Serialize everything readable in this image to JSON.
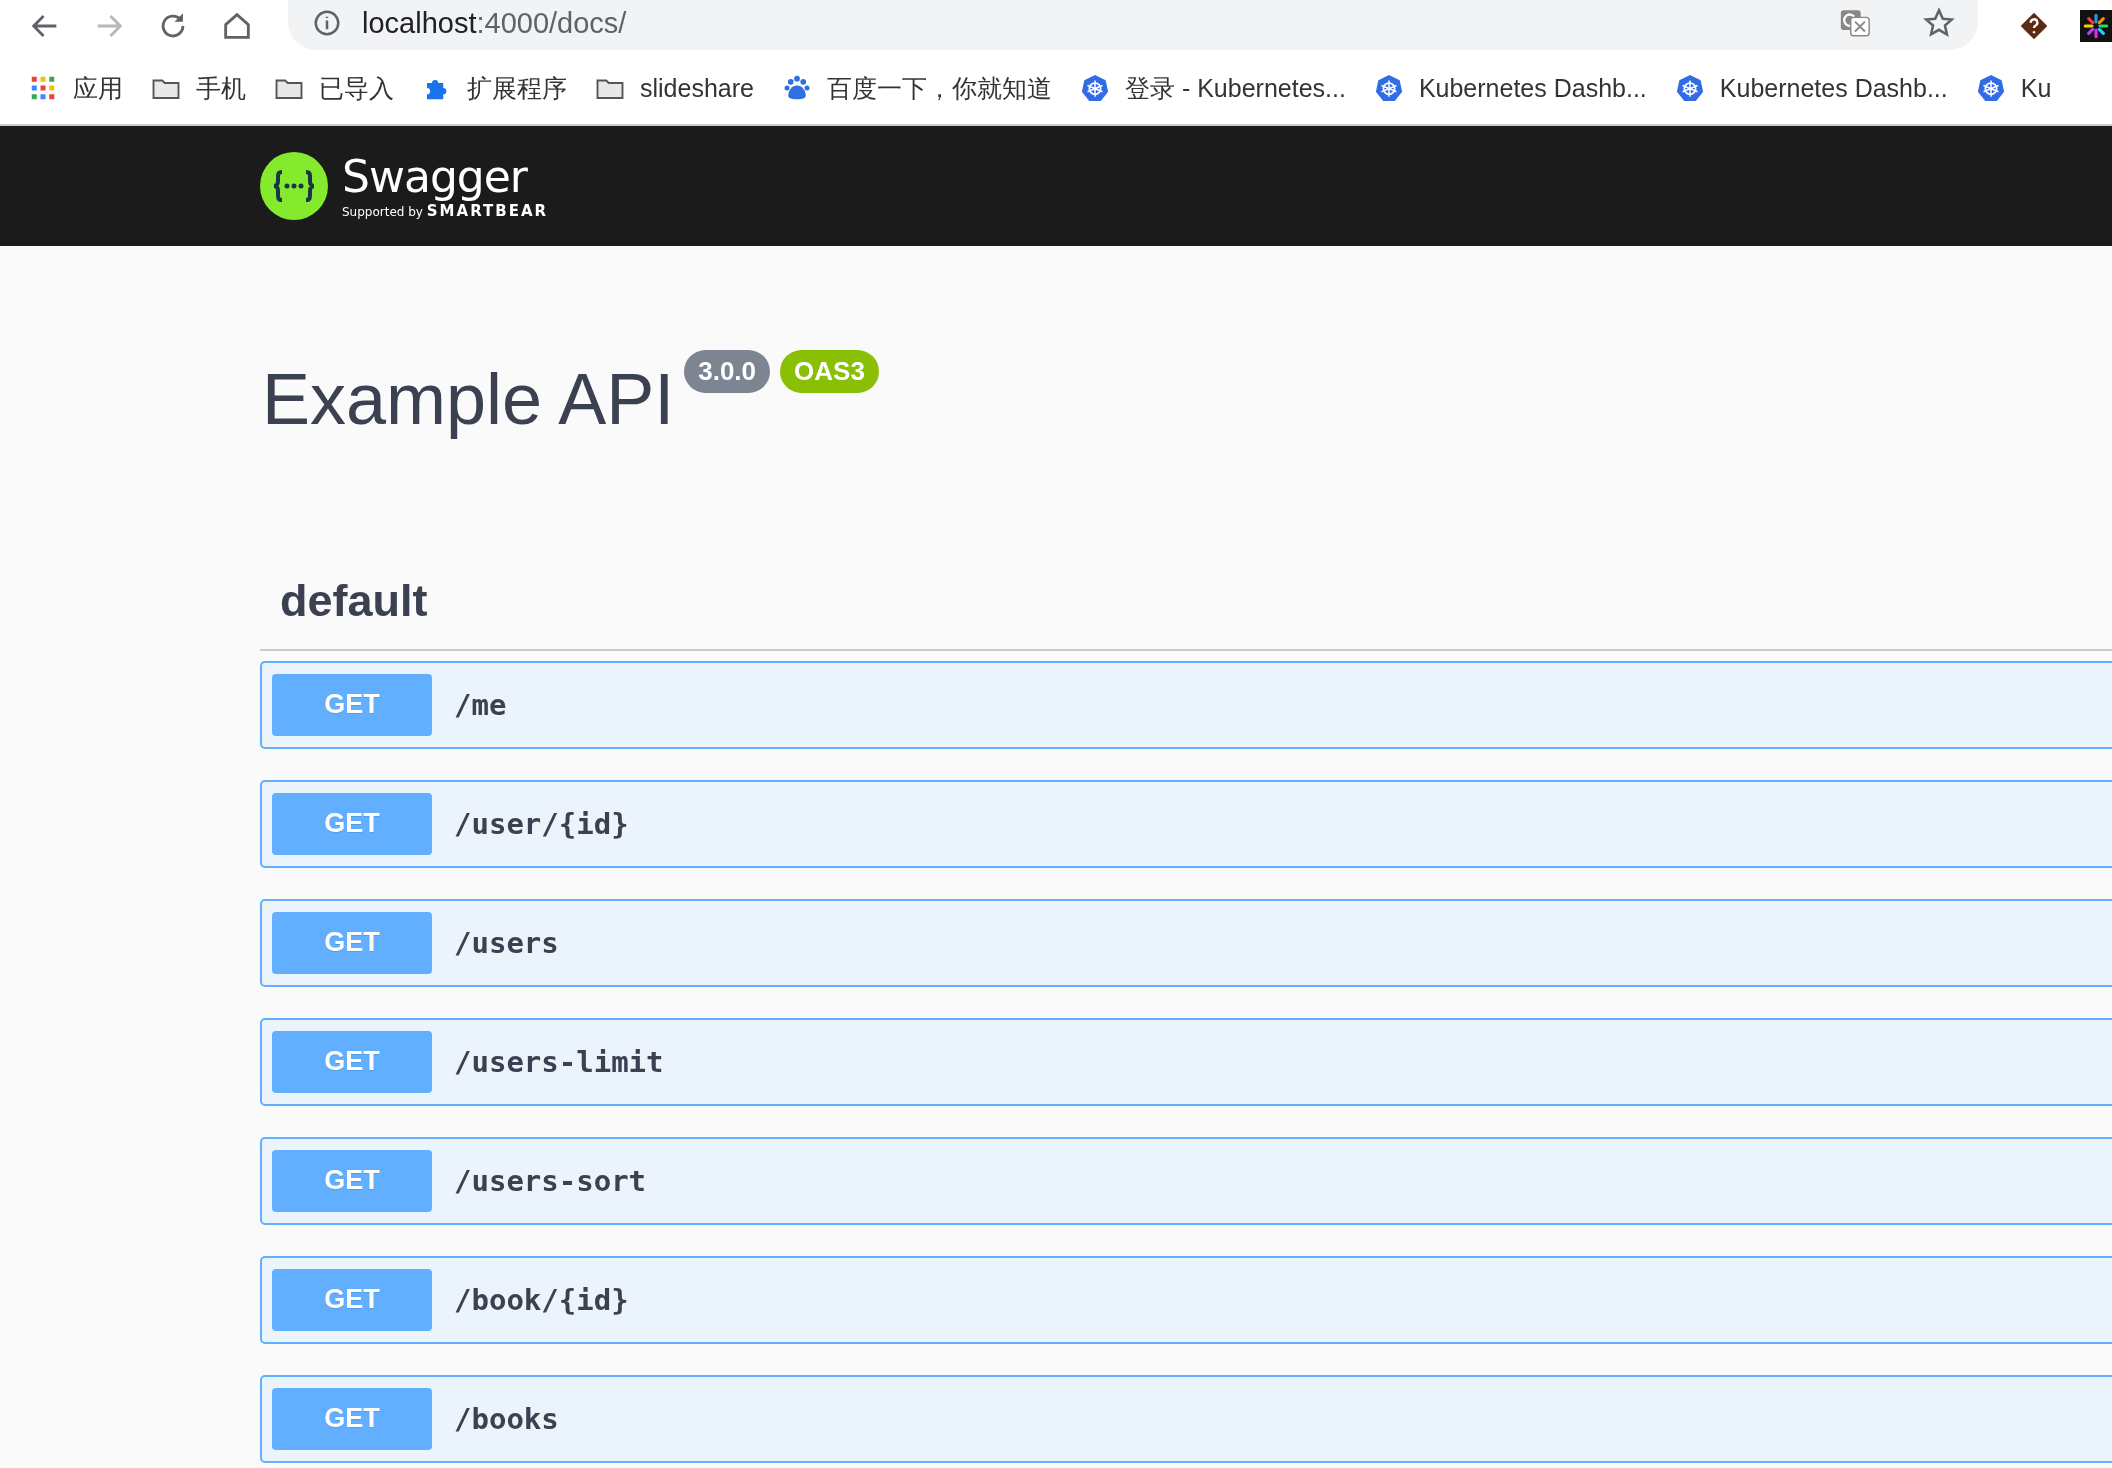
{
  "browser": {
    "url_host": "localhost",
    "url_rest": ":4000/docs/",
    "bookmarks": [
      {
        "kind": "apps",
        "label": "应用"
      },
      {
        "kind": "folder",
        "label": "手机"
      },
      {
        "kind": "folder",
        "label": "已导入"
      },
      {
        "kind": "extension",
        "label": "扩展程序"
      },
      {
        "kind": "folder",
        "label": "slideshare"
      },
      {
        "kind": "baidu",
        "label": "百度一下，你就知道"
      },
      {
        "kind": "kubernetes",
        "label": "登录 - Kubernetes..."
      },
      {
        "kind": "kubernetes",
        "label": "Kubernetes Dashb..."
      },
      {
        "kind": "kubernetes",
        "label": "Kubernetes Dashb..."
      },
      {
        "kind": "kubernetes",
        "label": "Ku"
      }
    ]
  },
  "header": {
    "brand": "Swagger",
    "tagline_prefix": "Supported by",
    "tagline_brand": "SMARTBEAR"
  },
  "info": {
    "title": "Example API",
    "version": "3.0.0",
    "spec_badge": "OAS3"
  },
  "section": {
    "name": "default"
  },
  "operations": [
    {
      "method": "GET",
      "path": "/me"
    },
    {
      "method": "GET",
      "path": "/user/{id}"
    },
    {
      "method": "GET",
      "path": "/users"
    },
    {
      "method": "GET",
      "path": "/users-limit"
    },
    {
      "method": "GET",
      "path": "/users-sort"
    },
    {
      "method": "GET",
      "path": "/book/{id}"
    },
    {
      "method": "GET",
      "path": "/books"
    }
  ]
}
